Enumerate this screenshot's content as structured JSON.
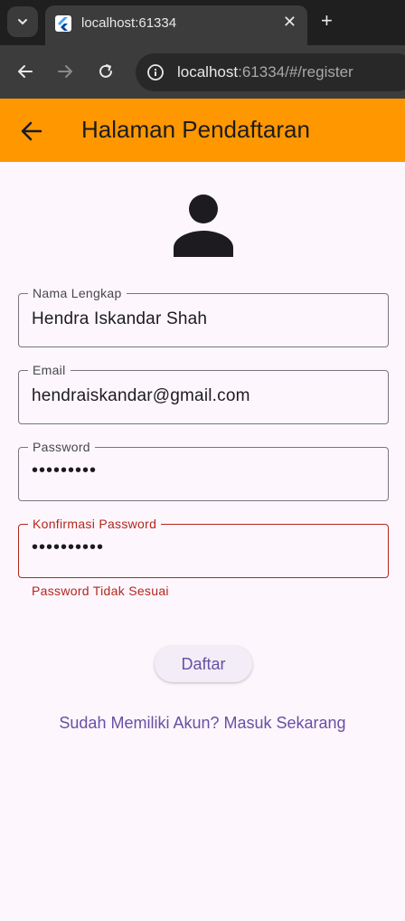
{
  "browser": {
    "tab_title": "localhost:61334",
    "url_host": "localhost",
    "url_rest": ":61334/#/register"
  },
  "appbar": {
    "title": "Halaman Pendaftaran"
  },
  "form": {
    "nama": {
      "label": "Nama Lengkap",
      "value": "Hendra Iskandar Shah"
    },
    "email": {
      "label": "Email",
      "value": "hendraiskandar@gmail.com"
    },
    "password": {
      "label": "Password",
      "value": "•••••••••"
    },
    "konfirmasi": {
      "label": "Konfirmasi Password",
      "value": "••••••••••",
      "error": "Password Tidak Sesuai"
    }
  },
  "actions": {
    "submit_label": "Daftar",
    "login_link": "Sudah Memiliki Akun? Masuk Sekarang"
  },
  "colors": {
    "appbar": "#ff9800",
    "error": "#b3261e",
    "primary": "#6750a4",
    "background": "#fdf7fd"
  }
}
